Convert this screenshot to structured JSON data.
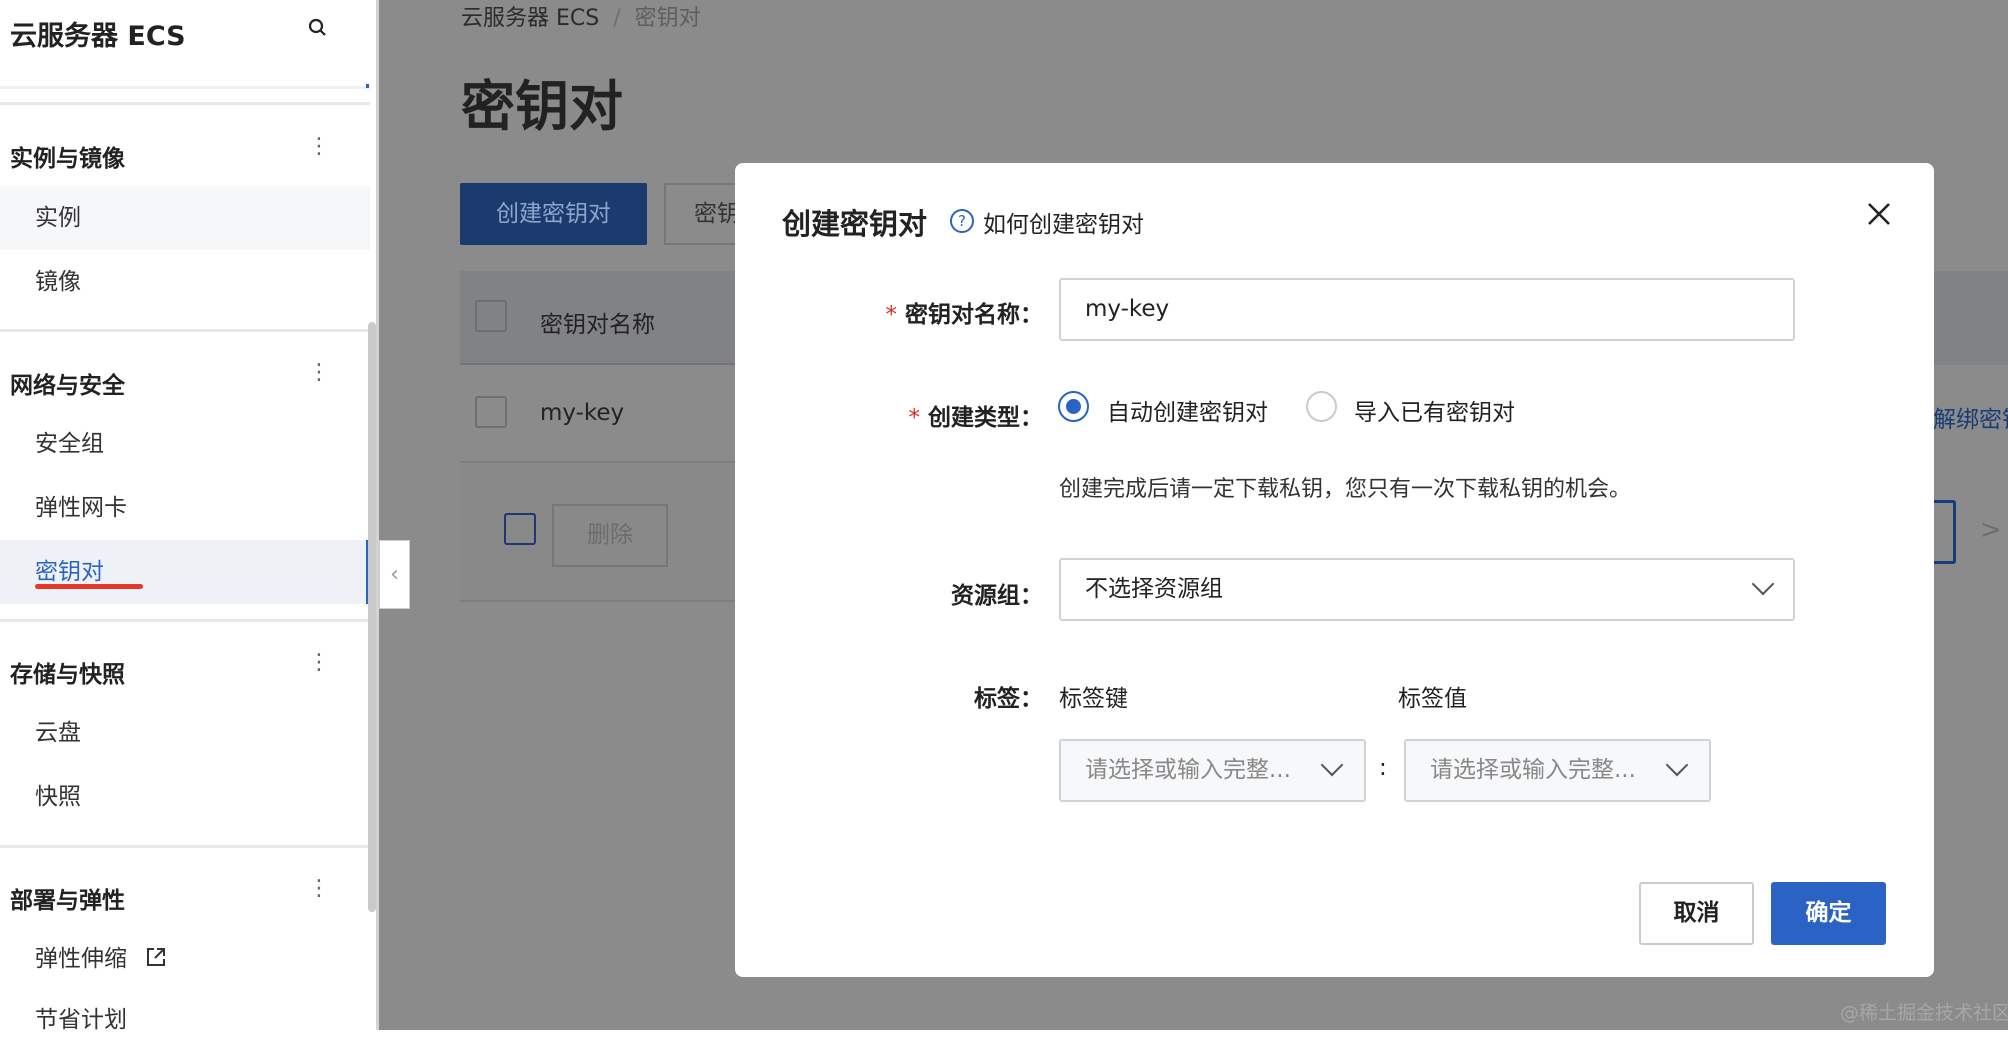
{
  "sidebar": {
    "title": "云服务器 ECS",
    "sections": [
      {
        "label": "实例与镜像",
        "items": [
          "实例",
          "镜像"
        ]
      },
      {
        "label": "网络与安全",
        "items": [
          "安全组",
          "弹性网卡",
          "密钥对"
        ]
      },
      {
        "label": "存储与快照",
        "items": [
          "云盘",
          "快照"
        ]
      },
      {
        "label": "部署与弹性",
        "items": [
          "弹性伸缩",
          "节省计划"
        ]
      }
    ],
    "active_item": "密钥对"
  },
  "main": {
    "breadcrumb": [
      "云服务器 ECS",
      "密钥对"
    ],
    "title": "密钥对",
    "create_button": "创建密钥对",
    "second_button": "密钥",
    "table": {
      "header": "密钥对名称",
      "rows": [
        {
          "name": "my-key",
          "action": "解绑密钥"
        }
      ]
    },
    "delete_button": "删除",
    "watermark": "@稀土掘金技术社区"
  },
  "modal": {
    "title": "创建密钥对",
    "help_link": "如何创建密钥对",
    "name_label": "密钥对名称：",
    "name_value": "my-key",
    "type_label": "创建类型：",
    "type_options": [
      "自动创建密钥对",
      "导入已有密钥对"
    ],
    "type_selected": "自动创建密钥对",
    "hint": "创建完成后请一定下载私钥，您只有一次下载私钥的机会。",
    "resource_group_label": "资源组：",
    "resource_group_value": "不选择资源组",
    "tags_label": "标签：",
    "tag_key_label": "标签键",
    "tag_value_label": "标签值",
    "tag_key_placeholder": "请选择或输入完整...",
    "tag_value_placeholder": "请选择或输入完整...",
    "tag_separator": ":",
    "cancel": "取消",
    "ok": "确定"
  },
  "colors": {
    "primary": "#2a63c4",
    "required": "#d93026",
    "underline": "#e5392b"
  }
}
